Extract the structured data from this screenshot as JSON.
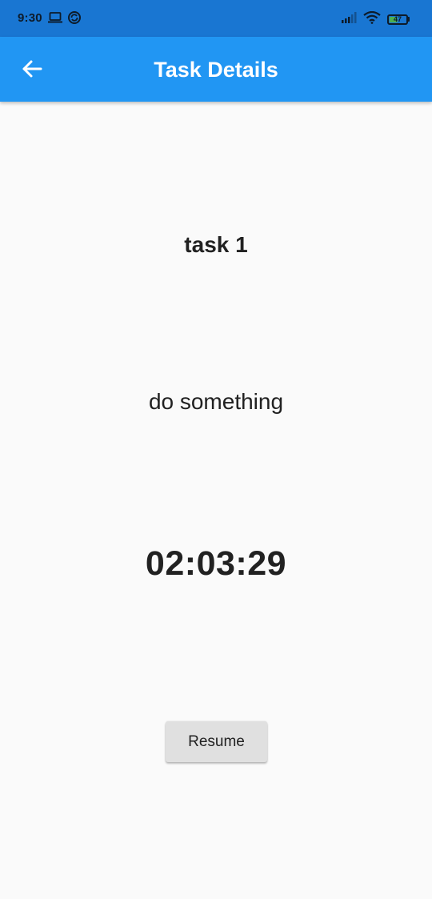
{
  "status_bar": {
    "time": "9:30",
    "battery_level": "47",
    "icons": [
      "laptop-icon",
      "sync-icon",
      "signal-icon",
      "wifi-icon",
      "battery-icon"
    ]
  },
  "app_bar": {
    "title": "Task Details",
    "back_icon": "arrow-left-icon"
  },
  "task": {
    "title": "task 1",
    "description": "do something",
    "timer": "02:03:29",
    "resume_label": "Resume"
  },
  "colors": {
    "status_bar": "#1976d2",
    "app_bar": "#2196f3",
    "background": "#fafafa",
    "button": "#e0e0e0",
    "text": "#212121"
  }
}
